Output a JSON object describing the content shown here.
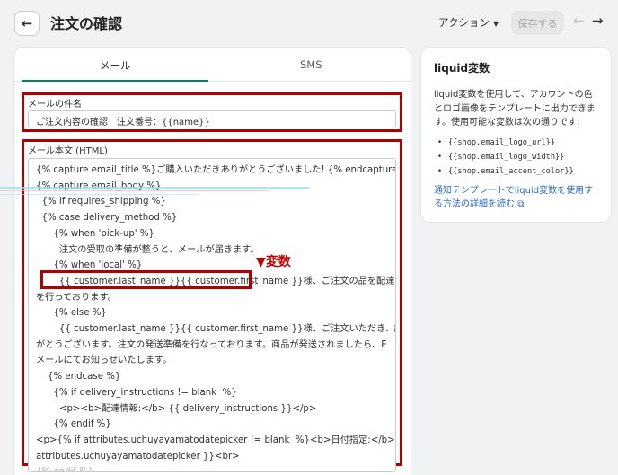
{
  "header": {
    "back_icon": "←",
    "title": "注文の確認",
    "action_label": "アクション",
    "action_caret": "▼",
    "save_label": "保存する",
    "prev_icon": "←",
    "next_icon": "→"
  },
  "tabs": [
    {
      "label": "メール",
      "active": true
    },
    {
      "label": "SMS",
      "active": false
    }
  ],
  "subject": {
    "label": "メールの件名",
    "value": "ご注文内容の確認　注文番号：{{name}}"
  },
  "body": {
    "label": "メール本文 (HTML)",
    "lines": [
      "{% capture email_title %}ご購入いただきありがとうございました! {% endcapture %}",
      "{% capture email_body %}",
      "  {% if requires_shipping %}",
      "  {% case delivery_method %}",
      "      {% when 'pick-up' %}",
      "        注文の受取の準備が整うと、メールが届きます。",
      "      {% when 'local' %}",
      "        {{ customer.last_name }}{{ customer.first_name }}様、ご注文の品を配達する準備",
      "を行っております。",
      "      {% else %}",
      "        {{ customer.last_name }}{{ customer.first_name }}様、ご注文いただき、誠にあり",
      "がとうございます。注文の発送準備を行なっております。商品が発送されましたら、E",
      "メールにてお知らせいたします。",
      "    {% endcase %}",
      "      {% if delivery_instructions != blank  %}",
      "        <p><b>配達情報:</b> {{ delivery_instructions }}</p>",
      "      {% endif %}",
      "<p>{% if attributes.uchuyayamatodatepicker != blank  %}<b>日付指定:</b>{{",
      "attributes.uchuyayamatodatepicker }}<br>",
      "{% endif %}"
    ]
  },
  "annotation": {
    "callout": "▼変数"
  },
  "sidebar": {
    "title": "liquid変数",
    "description": "liquid変数を使用して、アカウントの色とロゴ画像をテンプレートに出力できます。使用可能な変数は次の通りです:",
    "variables": [
      "{{shop.email_logo_url}}",
      "{{shop.email_logo_width}}",
      "{{shop.email_accent_color}}"
    ],
    "link_text": "通知テンプレートでliquid変数を使用する方法の詳細を読む",
    "link_icon": "⧉"
  },
  "colors": {
    "accent": "#008060",
    "annotation": "#b00000",
    "link": "#2c6ecb",
    "background": "#f1f2f4"
  }
}
